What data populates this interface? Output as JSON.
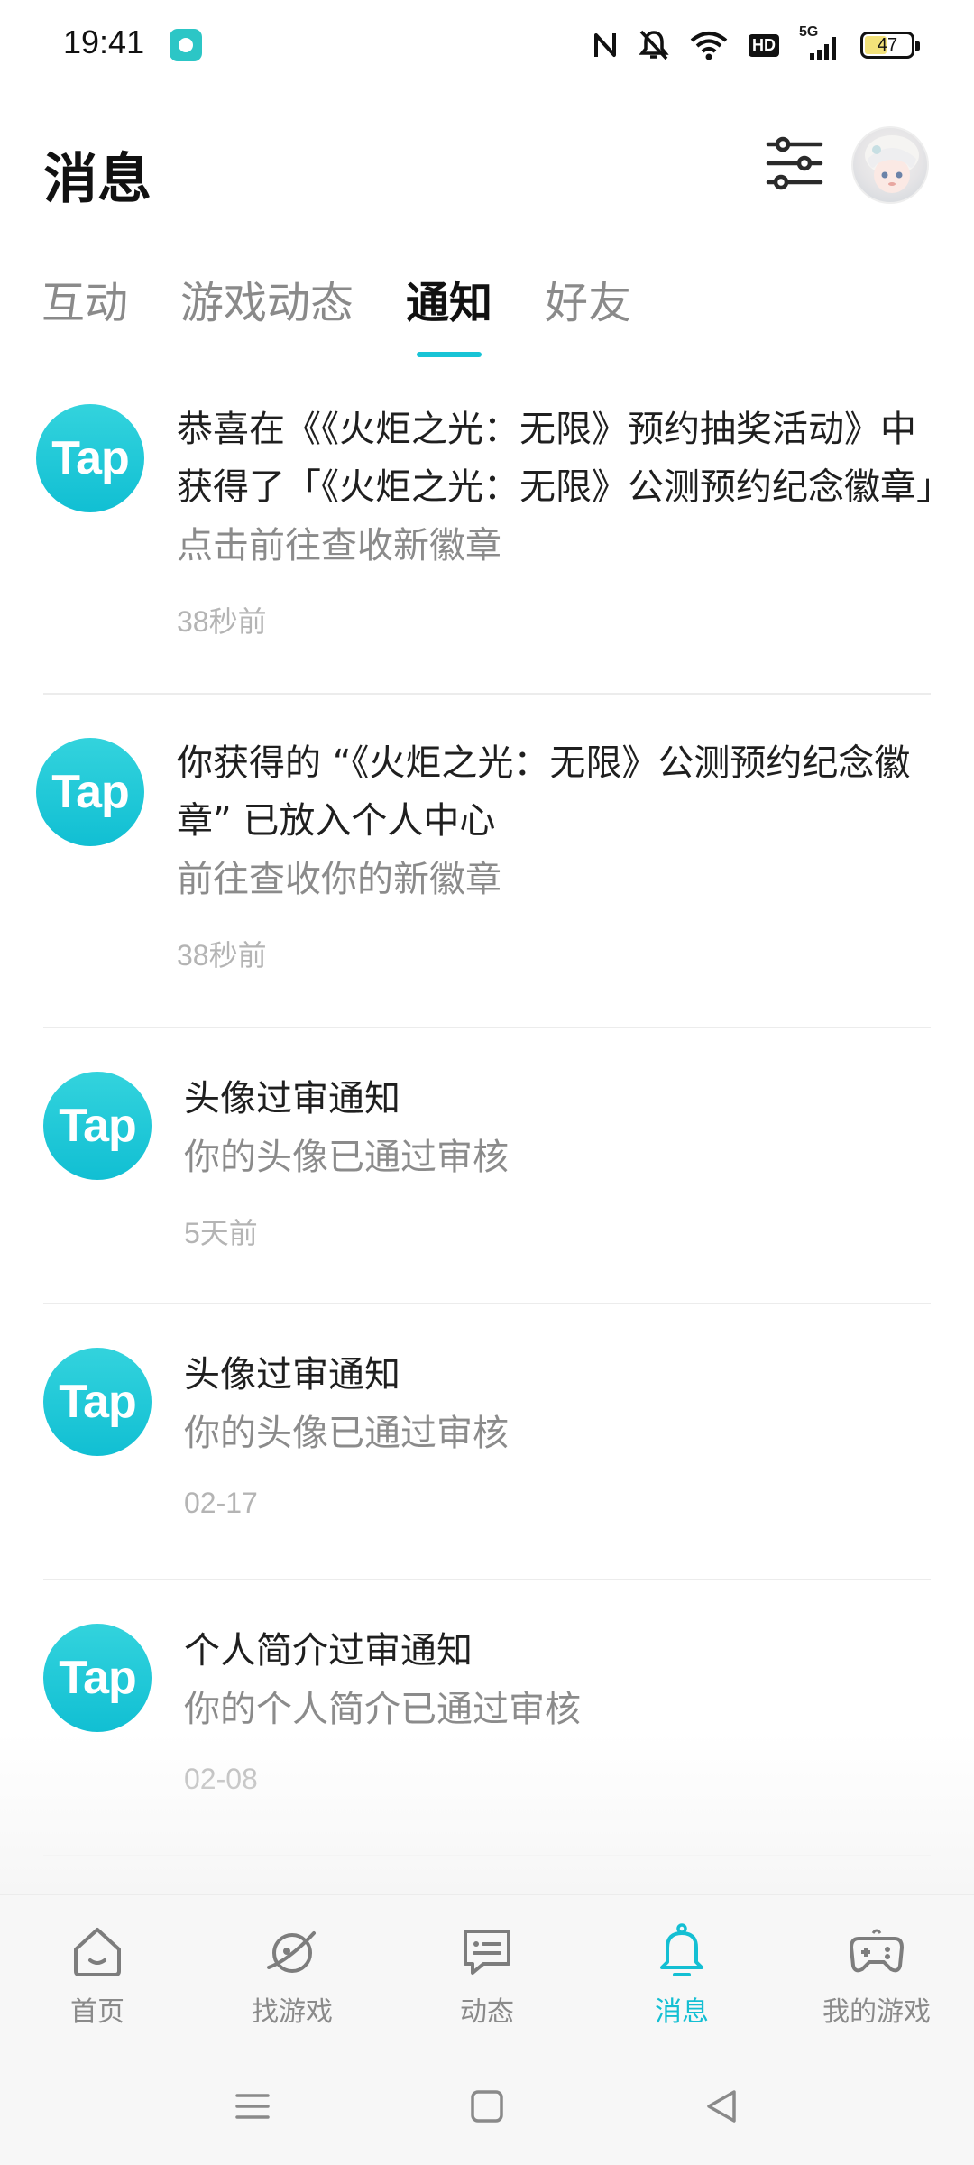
{
  "status_bar": {
    "time": "19:41",
    "network": "5G",
    "hd": "HD",
    "battery": "47",
    "icons": [
      "nfc-icon",
      "mute-icon",
      "wifi-icon",
      "hd-icon",
      "signal-icon",
      "battery-icon"
    ]
  },
  "header": {
    "title": "消息",
    "filter_icon": "sliders-icon",
    "avatar_icon": "user-avatar"
  },
  "tabs": [
    {
      "label": "互动",
      "active": false
    },
    {
      "label": "游戏动态",
      "active": false
    },
    {
      "label": "通知",
      "active": true
    },
    {
      "label": "好友",
      "active": false
    }
  ],
  "notifications": [
    {
      "logo": "Tap",
      "title": "恭喜在《《火炬之光：无限》预约抽奖活动》中获得了「《火炬之光：无限》公测预约纪念徽章」",
      "subtitle": "点击前往查收新徽章",
      "time": "38秒前"
    },
    {
      "logo": "Tap",
      "title": "你获得的 “《火炬之光：无限》公测预约纪念徽章” 已放入个人中心",
      "subtitle": "前往查收你的新徽章",
      "time": "38秒前"
    },
    {
      "logo": "Tap",
      "title": "头像过审通知",
      "subtitle": "你的头像已通过审核",
      "time": "5天前"
    },
    {
      "logo": "Tap",
      "title": "头像过审通知",
      "subtitle": "你的头像已通过审核",
      "time": "02-17"
    },
    {
      "logo": "Tap",
      "title": "个人简介过审通知",
      "subtitle": "你的个人简介已通过审核",
      "time": "02-08"
    }
  ],
  "bottom_nav": [
    {
      "label": "首页",
      "icon": "home-icon",
      "active": false
    },
    {
      "label": "找游戏",
      "icon": "planet-icon",
      "active": false
    },
    {
      "label": "动态",
      "icon": "chat-icon",
      "active": false
    },
    {
      "label": "消息",
      "icon": "bell-icon",
      "active": true
    },
    {
      "label": "我的游戏",
      "icon": "gamepad-icon",
      "active": false
    }
  ],
  "colors": {
    "accent": "#14bfd3",
    "tap_logo": "#1fc6d6",
    "muted_text": "#8b8b8b",
    "time_text": "#b4b4b4"
  }
}
